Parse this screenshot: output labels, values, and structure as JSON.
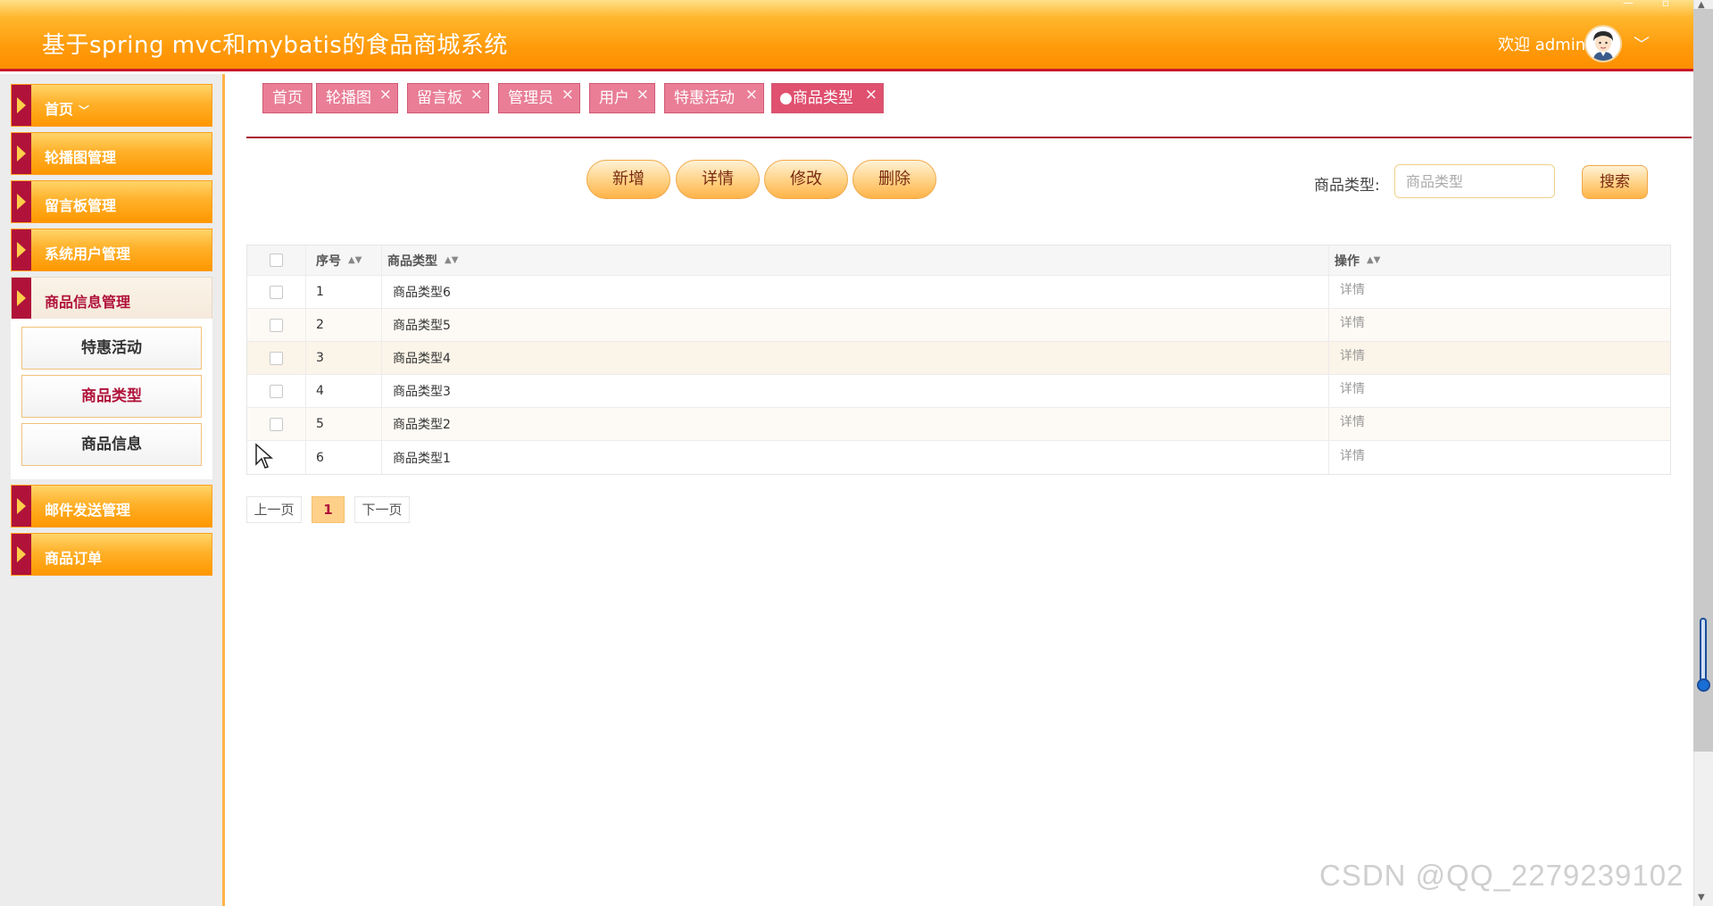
{
  "header": {
    "title": "基于spring mvc和mybatis的食品商城系统",
    "welcome": "欢迎 admin",
    "chevron": "﹀"
  },
  "sidebar": {
    "items": [
      {
        "label": "首页",
        "caret": "﹀"
      },
      {
        "label": "轮播图管理"
      },
      {
        "label": "留言板管理"
      },
      {
        "label": "系统用户管理"
      },
      {
        "label": "商品信息管理"
      },
      {
        "label": "邮件发送管理"
      },
      {
        "label": "商品订单"
      }
    ],
    "submenu": [
      {
        "label": "特惠活动"
      },
      {
        "label": "商品类型"
      },
      {
        "label": "商品信息"
      }
    ]
  },
  "tabs": [
    {
      "label": "首页"
    },
    {
      "label": "轮播图",
      "close": "×"
    },
    {
      "label": "留言板",
      "close": "×"
    },
    {
      "label": "管理员",
      "close": "×"
    },
    {
      "label": "用户",
      "close": "×"
    },
    {
      "label": "特惠活动",
      "close": "×"
    },
    {
      "label": "●商品类型",
      "close": "×"
    }
  ],
  "toolbar": {
    "add_label": "新增",
    "detail_label": "详情",
    "edit_label": "修改",
    "delete_label": "删除",
    "search_label": "商品类型:",
    "search_placeholder": "商品类型",
    "search_button": "搜索"
  },
  "table": {
    "columns": [
      "序号",
      "商品类型",
      "操作"
    ],
    "sort_icon": "▲▼",
    "rows": [
      {
        "no": "1",
        "type": "商品类型6",
        "op": "详情"
      },
      {
        "no": "2",
        "type": "商品类型5",
        "op": "详情"
      },
      {
        "no": "3",
        "type": "商品类型4",
        "op": "详情"
      },
      {
        "no": "4",
        "type": "商品类型3",
        "op": "详情"
      },
      {
        "no": "5",
        "type": "商品类型2",
        "op": "详情"
      },
      {
        "no": "6",
        "type": "商品类型1",
        "op": "详情"
      }
    ]
  },
  "pagination": {
    "prev": "上一页",
    "current": "1",
    "next": "下一页"
  },
  "watermark": "CSDN @QQ_2279239102",
  "colors": {
    "header_orange": "#ff9a0a",
    "accent_red": "#b0123a",
    "tab_pink": "#e97e96"
  }
}
